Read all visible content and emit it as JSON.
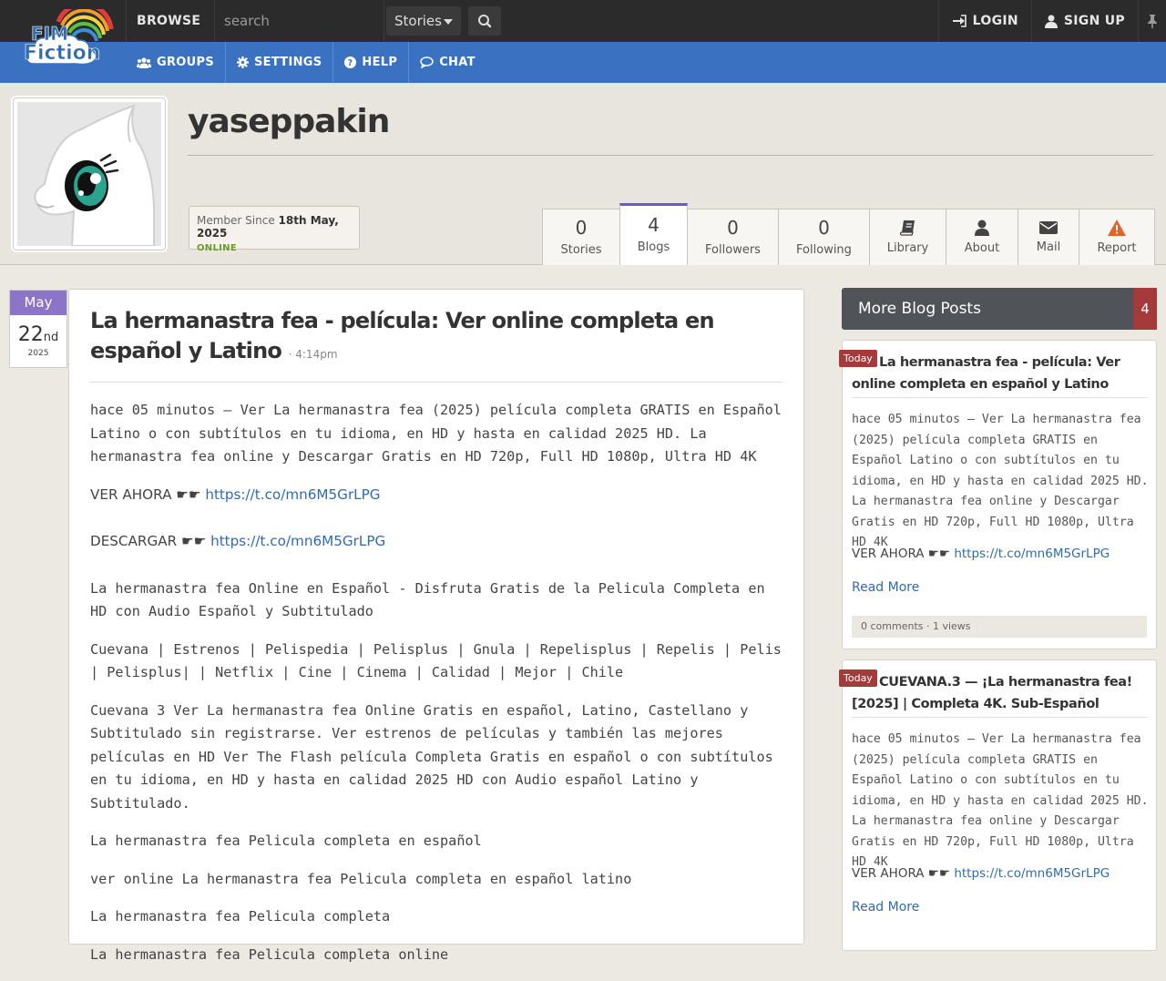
{
  "topbar": {
    "logo_text_1": "FIM",
    "logo_text_2": "Fiction",
    "browse_label": "BROWSE",
    "search_placeholder": "search",
    "search_scope": "Stories",
    "login_label": "LOGIN",
    "signup_label": "SIGN UP"
  },
  "nav": {
    "items": [
      {
        "label": "GROUPS",
        "icon": "users-icon"
      },
      {
        "label": "SETTINGS",
        "icon": "gear-icon"
      },
      {
        "label": "HELP",
        "icon": "question-icon"
      },
      {
        "label": "CHAT",
        "icon": "chat-icon"
      }
    ]
  },
  "profile": {
    "username": "yaseppakin",
    "member_since_label": "Member Since",
    "member_since_date": "18th May, 2025",
    "status": "ONLINE",
    "tabs": [
      {
        "num": "0",
        "label": "Stories"
      },
      {
        "num": "4",
        "label": "Blogs",
        "active": true
      },
      {
        "num": "0",
        "label": "Followers"
      },
      {
        "num": "0",
        "label": "Following"
      },
      {
        "icon": "book-icon",
        "label": "Library"
      },
      {
        "icon": "user-icon",
        "label": "About"
      },
      {
        "icon": "mail-icon",
        "label": "Mail"
      },
      {
        "icon": "warning-icon",
        "label": "Report"
      }
    ]
  },
  "post": {
    "month": "May",
    "day": "22",
    "day_suffix": "nd",
    "year": "2025",
    "title": "La hermanastra fea - película: Ver online completa en español y Latino",
    "time": "· 4:14pm",
    "p1": "hace 05 minutos — Ver La hermanastra fea (2025) película completa GRATIS en Español Latino o con subtítulos en tu idioma, en HD y hasta en calidad 2025 HD. La hermanastra fea online y Descargar Gratis en HD 720p, Full HD 1080p, Ultra HD 4K",
    "ver_label": "VER AHORA ☛☛",
    "ver_link": "https://t.co/mn6M5GrLPG",
    "desc_label": "DESCARGAR ☛☛",
    "desc_link": "https://t.co/mn6M5GrLPG",
    "p2": "La hermanastra fea Online en Español - Disfruta Gratis de la Pelicula Completa en HD con Audio Español y Subtitulado",
    "p3": "Cuevana | Estrenos | Pelispedia | Pelisplus | Gnula | Repelisplus | Repelis | Pelis | Pelisplus| | Netflix | Cine | Cinema | Calidad | Mejor | Chile",
    "p4": "Cuevana 3 Ver La hermanastra fea Online Gratis en español, Latino, Castellano y Subtitulado sin registrarse. Ver estrenos de películas y también las mejores películas en HD Ver The Flash película Completa Gratis en español o con subtítulos en tu idioma, en HD y hasta en calidad 2025 HD con Audio español Latino y Subtitulado.",
    "p5": "La hermanastra fea Pelicula completa en español",
    "p6": "ver online La hermanastra fea Pelicula completa en español latino",
    "p7": "La hermanastra fea Pelicula completa",
    "p8": "La hermanastra fea Pelicula completa online"
  },
  "sidebar": {
    "title": "More Blog Posts",
    "count": "4",
    "cards": [
      {
        "badge": "Today",
        "title": "La hermanastra fea - película: Ver online completa en español y Latino",
        "body": "hace 05 minutos — Ver La hermanastra fea (2025) película completa GRATIS en Español Latino o con subtítulos en tu idioma, en HD y hasta en calidad 2025 HD. La hermanastra fea online y Descargar Gratis en HD 720p, Full HD 1080p, Ultra HD 4K",
        "ver_label": "VER AHORA ☛☛",
        "ver_link": "https://t.co/mn6M5GrLPG",
        "read_more": "Read More",
        "stats": "0 comments · 1 views"
      },
      {
        "badge": "Today",
        "title": "CUEVANA.3 — ¡La hermanastra fea! [2025] | Completa 4K. Sub-Español",
        "body": "hace 05 minutos — Ver La hermanastra fea (2025) película completa GRATIS en Español Latino o con subtítulos en tu idioma, en HD y hasta en calidad 2025 HD. La hermanastra fea online y Descargar Gratis en HD 720p, Full HD 1080p, Ultra HD 4K",
        "ver_label": "VER AHORA ☛☛",
        "ver_link": "https://t.co/mn6M5GrLPG",
        "read_more": "Read More"
      }
    ]
  },
  "colors": {
    "topbar": "#2b2b2b",
    "navbar": "#3a72c1",
    "accent_purple": "#8c74c9",
    "badge_red": "#a43a3a",
    "link": "#2f6bb0",
    "online_green": "#6a9d24"
  }
}
